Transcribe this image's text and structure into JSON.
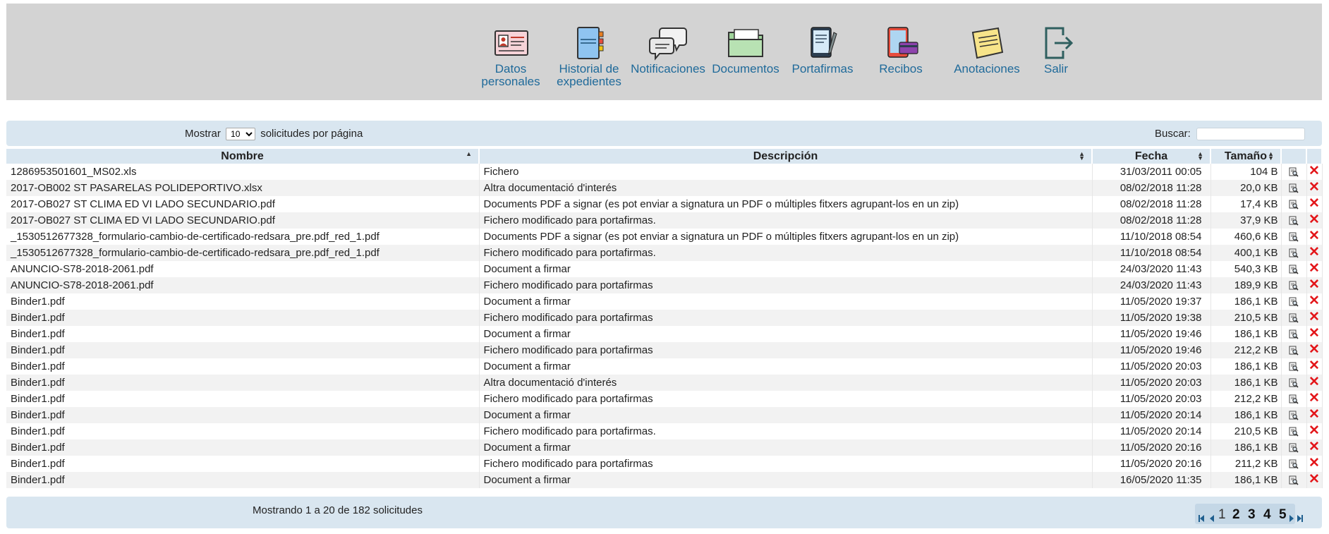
{
  "nav": [
    {
      "label_1": "Datos",
      "label_2": "personales",
      "icon": "id-card-icon"
    },
    {
      "label_1": "Historial de",
      "label_2": "expedientes",
      "icon": "notebook-icon"
    },
    {
      "label_1": "Notificaciones",
      "label_2": "",
      "icon": "speech-bubbles-icon"
    },
    {
      "label_1": "Documentos",
      "label_2": "",
      "icon": "folder-icon"
    },
    {
      "label_1": "Portafirmas",
      "label_2": "",
      "icon": "tablet-pen-icon"
    },
    {
      "label_1": "Recibos",
      "label_2": "",
      "icon": "tablet-card-icon"
    },
    {
      "label_1": "Anotaciones",
      "label_2": "",
      "icon": "sticky-note-icon"
    },
    {
      "label_1": "Salir",
      "label_2": "",
      "icon": "exit-icon"
    }
  ],
  "toolbar": {
    "show_label": "Mostrar",
    "per_page_value": "10",
    "per_page_suffix": "solicitudes por página",
    "search_label": "Buscar:",
    "search_value": ""
  },
  "table": {
    "headers": [
      "Nombre",
      "Descripción",
      "Fecha",
      "Tamaño"
    ],
    "rows": [
      {
        "name": "1286953501601_MS02.xls",
        "desc": "Fichero",
        "date": "31/03/2011 00:05",
        "size": "104 B"
      },
      {
        "name": "2017-OB002 ST PASARELAS POLIDEPORTIVO.xlsx",
        "desc": "Altra documentació d'interés",
        "date": "08/02/2018 11:28",
        "size": "20,0 KB"
      },
      {
        "name": "2017-OB027 ST CLIMA ED VI LADO SECUNDARIO.pdf",
        "desc": "Documents PDF a signar (es pot enviar a signatura un PDF o múltiples fitxers agrupant-los en un zip)",
        "date": "08/02/2018 11:28",
        "size": "17,4 KB"
      },
      {
        "name": "2017-OB027 ST CLIMA ED VI LADO SECUNDARIO.pdf",
        "desc": "Fichero modificado para portafirmas.",
        "date": "08/02/2018 11:28",
        "size": "37,9 KB"
      },
      {
        "name": "_1530512677328_formulario-cambio-de-certificado-redsara_pre.pdf_red_1.pdf",
        "desc": "Documents PDF a signar (es pot enviar a signatura un PDF o múltiples fitxers agrupant-los en un zip)",
        "date": "11/10/2018 08:54",
        "size": "460,6 KB"
      },
      {
        "name": "_1530512677328_formulario-cambio-de-certificado-redsara_pre.pdf_red_1.pdf",
        "desc": "Fichero modificado para portafirmas.",
        "date": "11/10/2018 08:54",
        "size": "400,1 KB"
      },
      {
        "name": "ANUNCIO-S78-2018-2061.pdf",
        "desc": "Document a firmar",
        "date": "24/03/2020 11:43",
        "size": "540,3 KB"
      },
      {
        "name": "ANUNCIO-S78-2018-2061.pdf",
        "desc": "Fichero modificado para portafirmas",
        "date": "24/03/2020 11:43",
        "size": "189,9 KB"
      },
      {
        "name": "Binder1.pdf",
        "desc": "Document a firmar",
        "date": "11/05/2020 19:37",
        "size": "186,1 KB"
      },
      {
        "name": "Binder1.pdf",
        "desc": "Fichero modificado para portafirmas",
        "date": "11/05/2020 19:38",
        "size": "210,5 KB"
      },
      {
        "name": "Binder1.pdf",
        "desc": "Document a firmar",
        "date": "11/05/2020 19:46",
        "size": "186,1 KB"
      },
      {
        "name": "Binder1.pdf",
        "desc": "Fichero modificado para portafirmas",
        "date": "11/05/2020 19:46",
        "size": "212,2 KB"
      },
      {
        "name": "Binder1.pdf",
        "desc": "Document a firmar",
        "date": "11/05/2020 20:03",
        "size": "186,1 KB"
      },
      {
        "name": "Binder1.pdf",
        "desc": "Altra documentació d'interés",
        "date": "11/05/2020 20:03",
        "size": "186,1 KB"
      },
      {
        "name": "Binder1.pdf",
        "desc": "Fichero modificado para portafirmas",
        "date": "11/05/2020 20:03",
        "size": "212,2 KB"
      },
      {
        "name": "Binder1.pdf",
        "desc": "Document a firmar",
        "date": "11/05/2020 20:14",
        "size": "186,1 KB"
      },
      {
        "name": "Binder1.pdf",
        "desc": "Fichero modificado para portafirmas.",
        "date": "11/05/2020 20:14",
        "size": "210,5 KB"
      },
      {
        "name": "Binder1.pdf",
        "desc": "Document a firmar",
        "date": "11/05/2020 20:16",
        "size": "186,1 KB"
      },
      {
        "name": "Binder1.pdf",
        "desc": "Fichero modificado para portafirmas",
        "date": "11/05/2020 20:16",
        "size": "211,2 KB"
      },
      {
        "name": "Binder1.pdf",
        "desc": "Document a firmar",
        "date": "16/05/2020 11:35",
        "size": "186,1 KB"
      }
    ],
    "row_actions": {
      "view_icon": "magnifier-document-icon",
      "delete_icon": "delete-x-icon",
      "delete_color": "#e3161a"
    }
  },
  "footer": {
    "info": "Mostrando 1 a 20 de 182 solicitudes",
    "pages": [
      "1",
      "2",
      "3",
      "4",
      "5"
    ],
    "current_page": "1"
  },
  "colors": {
    "topbar_bg": "#d3d3d3",
    "panel_bg": "#d9e6f0",
    "nav_text": "#1f6a9a",
    "row_alt": "#f2f2f2"
  }
}
